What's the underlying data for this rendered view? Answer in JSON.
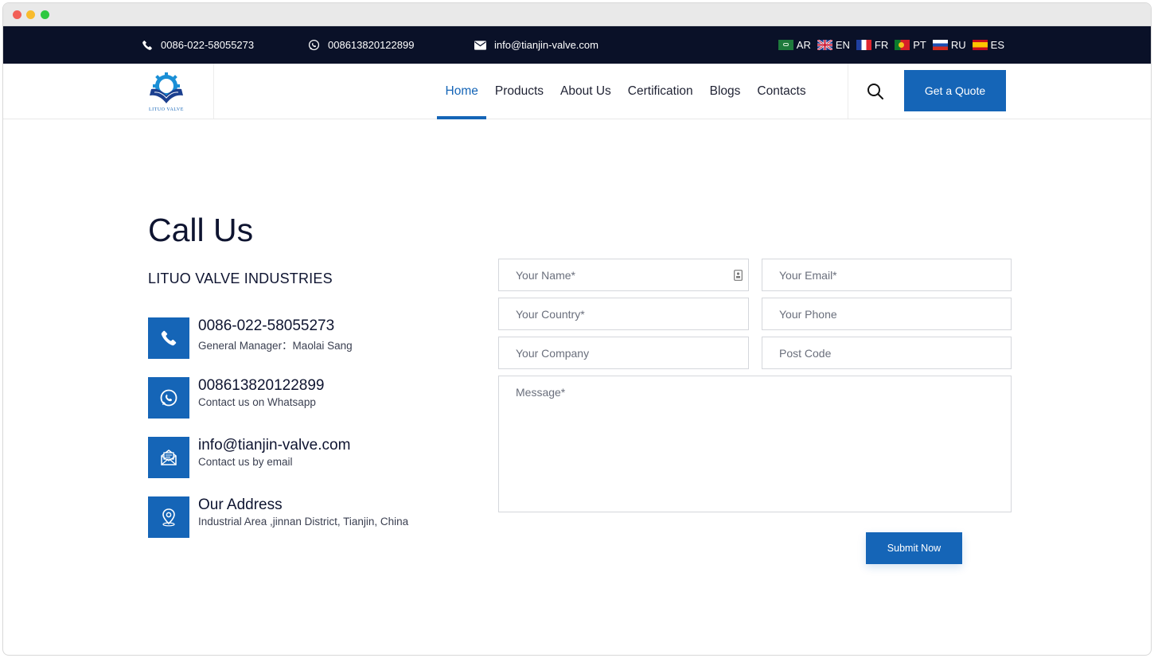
{
  "window": {
    "controls": [
      "close",
      "minimize",
      "maximize"
    ]
  },
  "topbar": {
    "phone": "0086-022-58055273",
    "whatsapp": "008613820122899",
    "email": "info@tianjin-valve.com",
    "languages": [
      {
        "code": "AR",
        "flag": "saudi-flag"
      },
      {
        "code": "EN",
        "flag": "uk-flag"
      },
      {
        "code": "FR",
        "flag": "france-flag"
      },
      {
        "code": "PT",
        "flag": "portugal-flag"
      },
      {
        "code": "RU",
        "flag": "russia-flag"
      },
      {
        "code": "ES",
        "flag": "spain-flag"
      }
    ]
  },
  "header": {
    "logo_text": "LITUO VALVE",
    "menu": [
      {
        "label": "Home",
        "active": true
      },
      {
        "label": "Products",
        "active": false
      },
      {
        "label": "About Us",
        "active": false
      },
      {
        "label": "Certification",
        "active": false
      },
      {
        "label": "Blogs",
        "active": false
      },
      {
        "label": "Contacts",
        "active": false
      }
    ],
    "quote_button": "Get a Quote"
  },
  "main": {
    "title": "Call Us",
    "company": "LITUO VALVE INDUSTRIES",
    "contacts": [
      {
        "icon": "phone-icon",
        "main": "0086-022-58055273",
        "sub": "General Manager：Maolai Sang"
      },
      {
        "icon": "whatsapp-icon",
        "main": "008613820122899",
        "sub": "Contact us on Whatsapp"
      },
      {
        "icon": "email-icon",
        "main": "info@tianjin-valve.com",
        "sub": "Contact us by email"
      },
      {
        "icon": "location-icon",
        "main": "Our Address",
        "sub": "Industrial Area ,jinnan District, Tianjin, China"
      }
    ]
  },
  "form": {
    "name_placeholder": "Your Name*",
    "email_placeholder": "Your Email*",
    "country_placeholder": "Your Country*",
    "phone_placeholder": "Your Phone",
    "company_placeholder": "Your Company",
    "postcode_placeholder": "Post Code",
    "message_placeholder": "Message*",
    "submit_label": "Submit Now"
  },
  "colors": {
    "brand": "#1565b7",
    "topbar": "#0a1128",
    "text": "#0e1430"
  }
}
